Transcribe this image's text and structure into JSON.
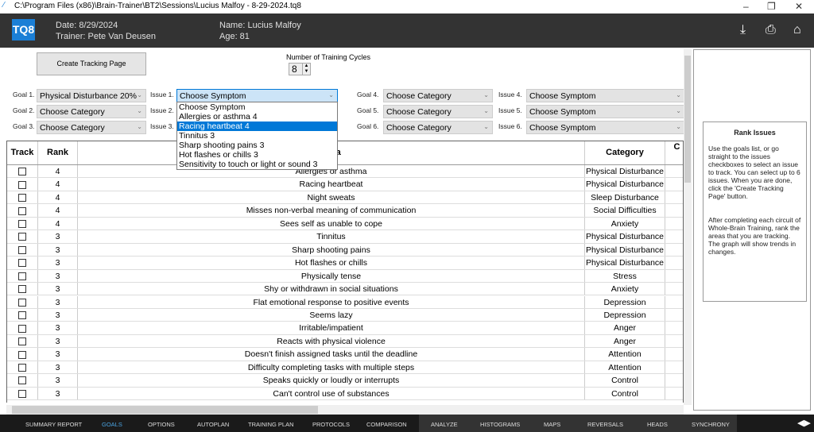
{
  "window": {
    "title": "C:\\Program Files (x86)\\Brain-Trainer\\BT2\\Sessions\\Lucius Malfoy - 8-29-2024.tq8",
    "minimize": "–",
    "restore": "❐",
    "close": "✕"
  },
  "header": {
    "logo": "TQ8",
    "date": "Date: 8/29/2024",
    "trainer": "Trainer: Pete Van Deusen",
    "name": "Name: Lucius Malfoy",
    "age": "Age: 81",
    "icons": [
      "download-icon",
      "print-icon",
      "home-icon"
    ]
  },
  "controls": {
    "create_button": "Create Tracking Page",
    "cycles_label": "Number of Training Cycles",
    "cycles_value": "8"
  },
  "goals": [
    {
      "label": "Goal 1.",
      "value": "Physical Disturbance 20%",
      "issue_label": "Issue 1.",
      "issue_value": "Choose Symptom"
    },
    {
      "label": "Goal 2.",
      "value": "Choose Category",
      "issue_label": "Issue 2.",
      "issue_value": ""
    },
    {
      "label": "Goal 3.",
      "value": "Choose Category",
      "issue_label": "Issue 3.",
      "issue_value": ""
    },
    {
      "label": "Goal 4.",
      "value": "Choose Category",
      "issue_label": "Issue 4.",
      "issue_value": "Choose Symptom"
    },
    {
      "label": "Goal 5.",
      "value": "Choose Category",
      "issue_label": "Issue 5.",
      "issue_value": "Choose Symptom"
    },
    {
      "label": "Goal 6.",
      "value": "Choose Category",
      "issue_label": "Issue 6.",
      "issue_value": "Choose Symptom"
    }
  ],
  "dropdown": {
    "options": [
      "Choose Symptom",
      "Allergies or asthma 4",
      "Racing heartbeat 4",
      "Tinnitus 3",
      "Sharp shooting pains 3",
      "Hot flashes or chills 3",
      "Sensitivity to touch or light or sound 3"
    ],
    "selected_index": 2
  },
  "table": {
    "headers": [
      "Track",
      "Rank",
      "Area",
      "Category",
      "C"
    ],
    "rows": [
      {
        "rank": "4",
        "area": "Allergies or asthma",
        "category": "Physical Disturbance"
      },
      {
        "rank": "4",
        "area": "Racing heartbeat",
        "category": "Physical Disturbance"
      },
      {
        "rank": "4",
        "area": "Night sweats",
        "category": "Sleep Disturbance"
      },
      {
        "rank": "4",
        "area": "Misses non-verbal meaning of communication",
        "category": "Social Difficulties"
      },
      {
        "rank": "4",
        "area": "Sees self as unable to cope",
        "category": "Anxiety"
      },
      {
        "rank": "3",
        "area": "Tinnitus",
        "category": "Physical Disturbance"
      },
      {
        "rank": "3",
        "area": "Sharp shooting pains",
        "category": "Physical Disturbance"
      },
      {
        "rank": "3",
        "area": "Hot flashes or chills",
        "category": "Physical Disturbance"
      },
      {
        "rank": "3",
        "area": "Physically tense",
        "category": "Stress"
      },
      {
        "rank": "3",
        "area": "Shy or withdrawn in social situations",
        "category": "Anxiety"
      },
      {
        "rank": "3",
        "area": "Flat emotional response to positive events",
        "category": "Depression"
      },
      {
        "rank": "3",
        "area": "Seems lazy",
        "category": "Depression"
      },
      {
        "rank": "3",
        "area": "Irritable/impatient",
        "category": "Anger"
      },
      {
        "rank": "3",
        "area": "Reacts with physical violence",
        "category": "Anger"
      },
      {
        "rank": "3",
        "area": "Doesn't finish assigned tasks until the deadline",
        "category": "Attention"
      },
      {
        "rank": "3",
        "area": "Difficulty completing tasks with multiple steps",
        "category": "Attention"
      },
      {
        "rank": "3",
        "area": "Speaks quickly or loudly or interrupts",
        "category": "Control"
      },
      {
        "rank": "3",
        "area": "Can't control use of substances",
        "category": "Control"
      }
    ]
  },
  "help": {
    "title": "Rank Issues",
    "p1": "Use the goals list, or go straight to the issues checkboxes to select an issue to track. You can select up to 6 issues. When you are done, click the 'Create Tracking Page' button.",
    "p2": "After completing each circuit of Whole-Brain Training, rank the areas that you are tracking. The graph will show trends in changes."
  },
  "tabs": [
    "SUMMARY REPORT",
    "GOALS",
    "OPTIONS",
    "AUTOPLAN",
    "TRAINING PLAN",
    "PROTOCOLS",
    "COMPARISON",
    "ANALYZE",
    "HISTOGRAMS",
    "MAPS",
    "REVERSALS",
    "HEADS",
    "SYNCHRONY"
  ],
  "active_tab": "GOALS",
  "colors": {
    "header_bg": "#333333",
    "accent": "#0078d7",
    "active_tab": "#4aa3e0"
  }
}
